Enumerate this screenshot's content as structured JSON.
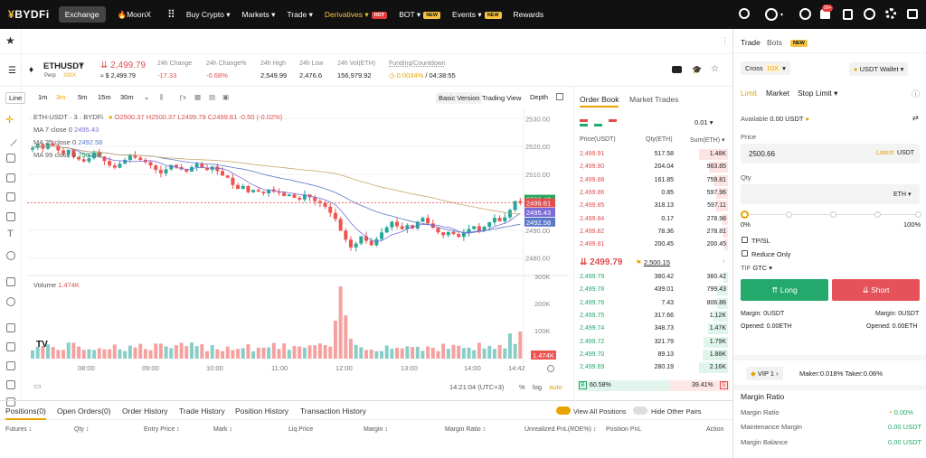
{
  "nav": {
    "logo": "BYDFi",
    "exchange": "Exchange",
    "moonx": "MoonX",
    "items": [
      "Buy Crypto",
      "Markets",
      "Trade",
      "Derivatives",
      "BOT",
      "Events",
      "Rewards"
    ],
    "hot": "HOT",
    "new": "NEW",
    "notif_count": "99+"
  },
  "symbol": {
    "name": "ETHUSDT",
    "type": "Perp",
    "lev": "200X",
    "price": "2,499.79",
    "usd_price": "≈ $ 2,499.79",
    "stats": [
      {
        "label": "24h Change",
        "value": "-17.33"
      },
      {
        "label": "24h Change%",
        "value": "-0.68%"
      },
      {
        "label": "24h High",
        "value": "2,549.99"
      },
      {
        "label": "24h Low",
        "value": "2,476.6"
      },
      {
        "label": "24h Vol(ETH)",
        "value": "156,979.92"
      }
    ],
    "funding_label": "Funding/Countdown",
    "funding_rate": "0.0034%",
    "countdown": "/ 04:38:55"
  },
  "chart_toolbar": {
    "intervals": [
      "Line",
      "1m",
      "3m",
      "5m",
      "15m",
      "30m"
    ],
    "basic": "Basic Version",
    "tv": "Trading View",
    "depth": "Depth"
  },
  "chart_legend": {
    "title": "ETH-USDT · 3 · BYDFi",
    "o": "O2500.37",
    "h": "H2500.37",
    "l": "L2499.79",
    "c": "C2499.81",
    "chg": "-0.50 (-0.02%)",
    "ma7": "MA 7 close 0",
    "ma7v": "2495.43",
    "ma25": "MA 25 close 0",
    "ma25v": "2492.58",
    "ma99": "MA 99 close 0",
    "ma99v": "2500.42",
    "volume": "Volume",
    "volv": "1.474K"
  },
  "chart_data": {
    "type": "candlestick",
    "price_axis": [
      "2530.00",
      "2520.00",
      "2510.00",
      "2500.00",
      "2490.00",
      "2480.00"
    ],
    "ylim": [
      2476,
      2533
    ],
    "volume_axis": [
      "300K",
      "200K",
      "100K"
    ],
    "time_axis": [
      "08:00",
      "09:00",
      "10:00",
      "11:00",
      "12:00",
      "13:00",
      "14:00",
      "14:42"
    ],
    "price_tags": [
      {
        "value": "2500.42",
        "color": "#26a65b"
      },
      {
        "value": "2499.81",
        "color": "#e04e4e"
      },
      {
        "value": "2495.43",
        "color": "#7b6cd9"
      },
      {
        "value": "2492.58",
        "color": "#5a78c9"
      }
    ],
    "volume_tag": "1.474K",
    "closes": [
      2519.5,
      2520.8,
      2519.2,
      2521,
      2520.4,
      2518.6,
      2517.4,
      2518.8,
      2516.2,
      2515.4,
      2514.6,
      2515.8,
      2517.8,
      2516.4,
      2514.8,
      2513.2,
      2512.4,
      2513.8,
      2515.2,
      2516.8,
      2516,
      2515.2,
      2514.4,
      2513.2,
      2511.6,
      2510.4,
      2511.8,
      2513.4,
      2512.6,
      2511.8,
      2511,
      2512.6,
      2513.8,
      2512.4,
      2511.6,
      2512.8,
      2511.2,
      2509.6,
      2508.8,
      2506.2,
      2504.8,
      2505.8,
      2503.6,
      2504.4,
      2503.8,
      2503.2,
      2504.6,
      2503.8,
      2503.4,
      2502.2,
      2502.8,
      2501.6,
      2501,
      2502.8,
      2501.8,
      2500.4,
      2499.8,
      2498.4,
      2496.2,
      2494,
      2489.8,
      2486.6,
      2483.8,
      2485.2,
      2487.8,
      2486.2,
      2484.6,
      2486.8,
      2489.2,
      2491,
      2493,
      2491.4,
      2490.4,
      2491.8,
      2490.6,
      2493,
      2494.4,
      2492.4,
      2490.8,
      2489.2,
      2488.2,
      2489.4,
      2488.6,
      2487.6,
      2489,
      2490.4,
      2491.4,
      2489.8,
      2491.2,
      2492.8,
      2494.4,
      2493.2,
      2494.6,
      2497.2,
      2500.4,
      2499.8
    ]
  },
  "orderbook": {
    "tabs": [
      "Order Book",
      "Market Trades"
    ],
    "precision": "0.01",
    "headers": [
      "Price(USDT)",
      "Qty(ETH)",
      "Sum(ETH)"
    ],
    "asks": [
      [
        "2,499.91",
        "517.58",
        "1.48K"
      ],
      [
        "2,499.90",
        "204.04",
        "963.85"
      ],
      [
        "2,499.88",
        "161.85",
        "759.81"
      ],
      [
        "2,499.86",
        "0.85",
        "597.96"
      ],
      [
        "2,499.85",
        "318.13",
        "597.11"
      ],
      [
        "2,499.84",
        "0.17",
        "278.98"
      ],
      [
        "2,499.82",
        "78.36",
        "278.81"
      ],
      [
        "2,499.81",
        "200.45",
        "200.45"
      ]
    ],
    "ask_depth": [
      1.0,
      0.65,
      0.51,
      0.4,
      0.4,
      0.19,
      0.19,
      0.14
    ],
    "mid": "2499.79",
    "mark": "2,500.15",
    "bids": [
      [
        "2,499.79",
        "360.42",
        "360.42"
      ],
      [
        "2,499.78",
        "439.01",
        "799.43"
      ],
      [
        "2,499.76",
        "7.43",
        "806.86"
      ],
      [
        "2,499.75",
        "317.66",
        "1.12K"
      ],
      [
        "2,499.74",
        "348.73",
        "1.47K"
      ],
      [
        "2,499.72",
        "321.79",
        "1.79K"
      ],
      [
        "2,499.70",
        "89.13",
        "1.88K"
      ],
      [
        "2,499.69",
        "280.19",
        "2.16K"
      ]
    ],
    "bid_depth": [
      0.17,
      0.37,
      0.37,
      0.52,
      0.68,
      0.83,
      0.87,
      1.0
    ],
    "buy_pct": "60.58%",
    "sell_pct": "39.41%",
    "buy_ratio": 0.6058
  },
  "trade": {
    "tabs": [
      "Trade",
      "Bots"
    ],
    "bots_badge": "NEW",
    "margin_mode": "Cross",
    "leverage": "10X",
    "wallet": "USDT Wallet",
    "order_types": [
      "Limit",
      "Market",
      "Stop Limit"
    ],
    "available_label": "Available",
    "available": "0.00 USDT",
    "price_label": "Price",
    "price_value": "2500.66",
    "latest": "Latest",
    "unit": "USDT",
    "qty_label": "Qty",
    "qty_unit": "ETH",
    "pct_min": "0%",
    "pct_max": "100%",
    "tpsl": "TP/SL",
    "reduce_only": "Reduce Only",
    "tif": "TIF",
    "tif_val": "GTC",
    "long": "Long",
    "short": "Short",
    "margin_l": "Margin: 0USDT",
    "margin_r": "Margin: 0USDT",
    "opened_l": "Opened: 0.00ETH",
    "opened_r": "Opened: 0.00ETH",
    "vip": "VIP 1",
    "fees": "Maker:0.018% Taker:0.06%",
    "margin_ratio_title": "Margin Ratio",
    "margin_rows": [
      {
        "label": "Margin Ratio",
        "value": "0.00%"
      },
      {
        "label": "Maintenance Margin",
        "value": "0.00 USDT"
      },
      {
        "label": "Margin Balance",
        "value": "0.00 USDT"
      }
    ]
  },
  "positions": {
    "tabs": [
      "Positions(0)",
      "Open Orders(0)",
      "Order History",
      "Trade History",
      "Position History",
      "Transaction History"
    ],
    "view_all": "View All Positions",
    "hide_pairs": "Hide Other Pairs",
    "columns": [
      "Futures",
      "Qty",
      "Entry Price",
      "Mark",
      "Liq.Price",
      "Margin",
      "Margin Ratio",
      "Unrealized PnL(ROE%)",
      "Position PnL",
      "Action"
    ]
  },
  "status": {
    "time": "14:21:04 (UTC+3)",
    "pct": "%",
    "log": "log",
    "auto": "auto"
  }
}
